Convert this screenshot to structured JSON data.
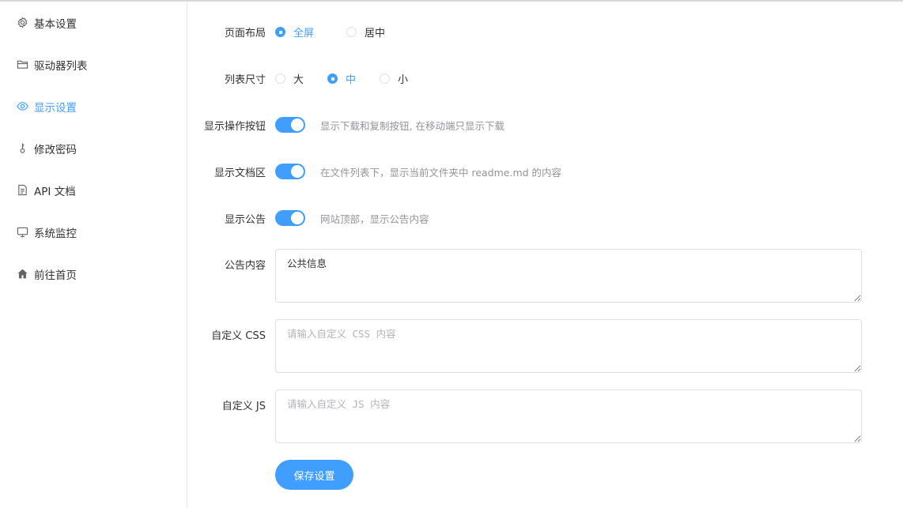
{
  "sidebar": {
    "items": [
      {
        "label": "基本设置",
        "icon": "gear-icon"
      },
      {
        "label": "驱动器列表",
        "icon": "folder-icon"
      },
      {
        "label": "显示设置",
        "icon": "eye-icon",
        "active": true
      },
      {
        "label": "修改密码",
        "icon": "key-icon"
      },
      {
        "label": "API 文档",
        "icon": "document-icon"
      },
      {
        "label": "系统监控",
        "icon": "monitor-icon"
      },
      {
        "label": "前往首页",
        "icon": "home-icon"
      }
    ]
  },
  "form": {
    "layout": {
      "label": "页面布局",
      "options": [
        "全屏",
        "居中"
      ],
      "selected": "全屏"
    },
    "list_size": {
      "label": "列表尺寸",
      "options": [
        "大",
        "中",
        "小"
      ],
      "selected": "中"
    },
    "show_buttons": {
      "label": "显示操作按钮",
      "enabled": true,
      "hint": "显示下载和复制按钮, 在移动端只显示下载"
    },
    "show_doc": {
      "label": "显示文档区",
      "enabled": true,
      "hint": "在文件列表下，显示当前文件夹中 readme.md 的内容"
    },
    "show_notice": {
      "label": "显示公告",
      "enabled": true,
      "hint": "网站顶部，显示公告内容"
    },
    "notice_content": {
      "label": "公告内容",
      "value": "公共信息"
    },
    "custom_css": {
      "label": "自定义 CSS",
      "placeholder": "请输入自定义 CSS 内容"
    },
    "custom_js": {
      "label": "自定义 JS",
      "placeholder": "请输入自定义 JS 内容"
    },
    "save_label": "保存设置"
  },
  "colors": {
    "accent": "#409eff",
    "text": "#303133",
    "hint": "#909399",
    "border": "#dcdfe6"
  }
}
